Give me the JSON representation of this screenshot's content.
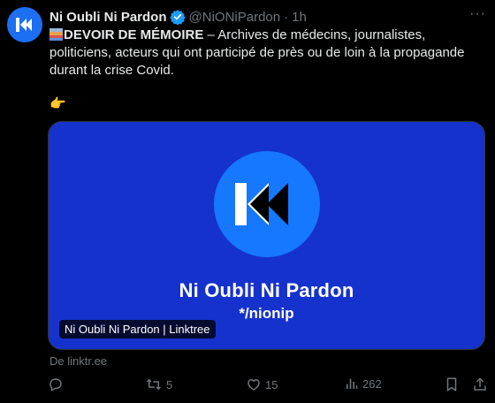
{
  "tweet": {
    "author_name": "Ni Oubli Ni Pardon",
    "handle": "@NiONiPardon",
    "separator": "·",
    "time": "1h",
    "text_bold": "DEVOIR DE MÉMOIRE",
    "text_rest": " – Archives de médecins, journalistes, politiciens, acteurs qui ont participé de près ou de loin à la propagande durant la crise Covid.",
    "pointer_emoji": "👉",
    "more_label": "···"
  },
  "card": {
    "title": "Ni Oubli Ni Pardon",
    "handle": "*/nionip",
    "label": "Ni Oubli Ni Pardon | Linktree",
    "source": "De linktr.ee",
    "bg_color": "#1632cc",
    "logo_color": "#1677ff"
  },
  "actions": {
    "reply_count": "",
    "retweet_count": "5",
    "like_count": "15",
    "views_count": "262"
  },
  "icons": [
    "avatar-logo",
    "verified-badge-icon",
    "more-icon",
    "reply-icon",
    "retweet-icon",
    "like-icon",
    "views-icon",
    "bookmark-icon",
    "share-icon"
  ]
}
